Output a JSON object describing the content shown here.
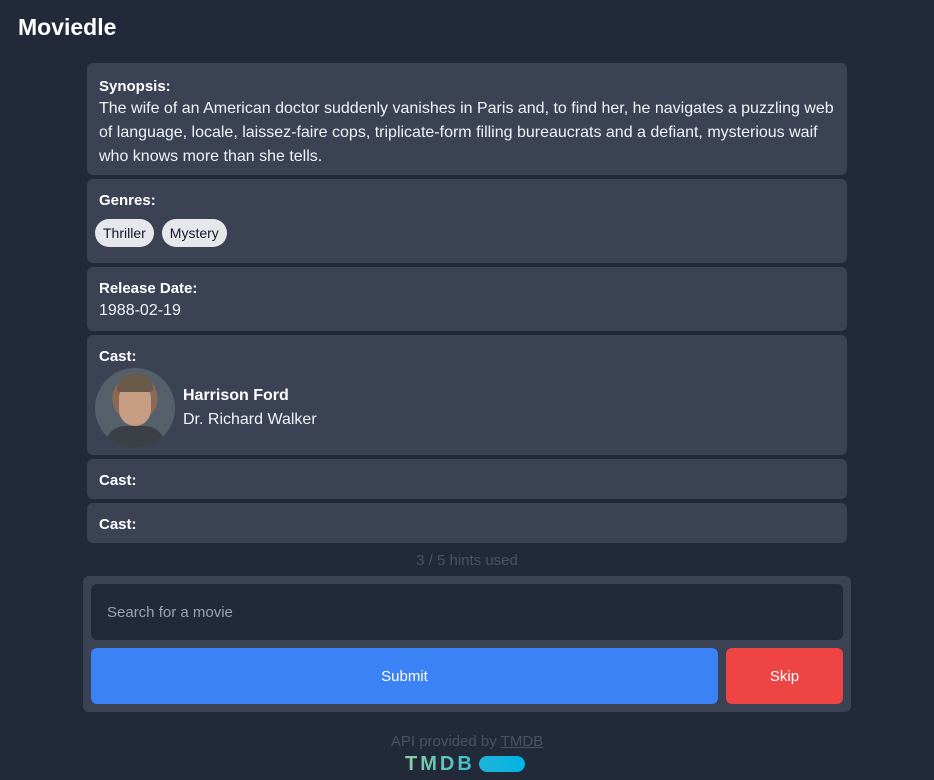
{
  "app": {
    "title": "Moviedle"
  },
  "synopsis": {
    "label": "Synopsis:",
    "text": "The wife of an American doctor suddenly vanishes in Paris and, to find her, he navigates a puzzling web of language, locale, laissez-faire cops, triplicate-form filling bureaucrats and a defiant, mysterious waif who knows more than she tells."
  },
  "genres": {
    "label": "Genres:",
    "items": [
      "Thriller",
      "Mystery"
    ]
  },
  "release": {
    "label": "Release Date:",
    "value": "1988-02-19"
  },
  "cast": [
    {
      "label": "Cast:",
      "name": "Harrison Ford",
      "role": "Dr. Richard Walker",
      "avatar_icon": "actor-photo"
    },
    {
      "label": "Cast:"
    },
    {
      "label": "Cast:"
    }
  ],
  "hints": {
    "used_text": "3 / 5 hints used"
  },
  "search": {
    "placeholder": "Search for a movie",
    "submit_label": "Submit",
    "skip_label": "Skip"
  },
  "footer": {
    "prefix": "API provided by",
    "link_text": "TMDB",
    "logo_text": "TMDB"
  },
  "colors": {
    "background": "#222a39",
    "card": "#3a4253",
    "submit": "#3b82f6",
    "skip": "#ef4444"
  }
}
